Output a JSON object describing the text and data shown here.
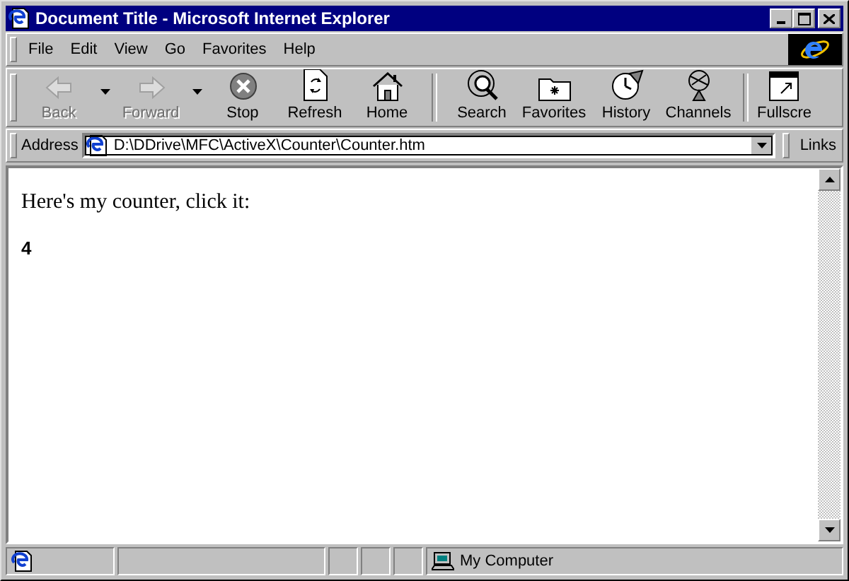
{
  "window": {
    "title": "Document Title - Microsoft Internet Explorer"
  },
  "menu": [
    "File",
    "Edit",
    "View",
    "Go",
    "Favorites",
    "Help"
  ],
  "toolbar": [
    {
      "kind": "back",
      "label": "Back",
      "disabled": true,
      "dropdown": true
    },
    {
      "kind": "forward",
      "label": "Forward",
      "disabled": true,
      "dropdown": true
    },
    {
      "kind": "stop",
      "label": "Stop",
      "disabled": false,
      "dropdown": false
    },
    {
      "kind": "refresh",
      "label": "Refresh",
      "disabled": false,
      "dropdown": false
    },
    {
      "kind": "home",
      "label": "Home",
      "disabled": false,
      "dropdown": false
    },
    {
      "kind": "separator"
    },
    {
      "kind": "search",
      "label": "Search",
      "disabled": false,
      "dropdown": false
    },
    {
      "kind": "favorites",
      "label": "Favorites",
      "disabled": false,
      "dropdown": false
    },
    {
      "kind": "history",
      "label": "History",
      "disabled": false,
      "dropdown": false
    },
    {
      "kind": "channels",
      "label": "Channels",
      "disabled": false,
      "dropdown": false
    },
    {
      "kind": "separator"
    },
    {
      "kind": "fullscreen",
      "label": "Fullscre",
      "disabled": false,
      "dropdown": false
    }
  ],
  "address": {
    "label": "Address",
    "value": "D:\\DDrive\\MFC\\ActiveX\\Counter\\Counter.htm",
    "links": "Links"
  },
  "page": {
    "text": "Here's my counter, click it:",
    "counter": "4"
  },
  "status_bar": {
    "zone": "My Computer"
  }
}
